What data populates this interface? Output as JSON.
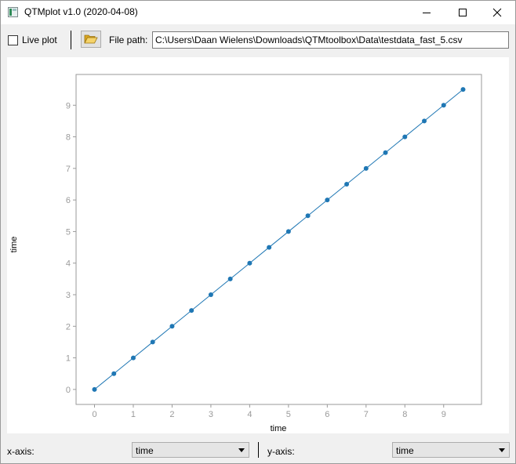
{
  "window": {
    "title": "QTMplot v1.0 (2020-04-08)",
    "icon": "app-icon"
  },
  "toolbar": {
    "live_plot_label": "Live plot",
    "live_plot_checked": false,
    "folder_icon": "folder-open-icon",
    "file_path_label": "File path:",
    "file_path_value": "C:\\Users\\Daan Wielens\\Downloads\\QTMtoolbox\\Data\\testdata_fast_5.csv"
  },
  "chart_data": {
    "type": "line",
    "x": [
      0,
      0.5,
      1,
      1.5,
      2,
      2.5,
      3,
      3.5,
      4,
      4.5,
      5,
      5.5,
      6,
      6.5,
      7,
      7.5,
      8,
      8.5,
      9,
      9.5
    ],
    "series": [
      {
        "values": [
          0,
          0.5,
          1,
          1.5,
          2,
          2.5,
          3,
          3.5,
          4,
          4.5,
          5,
          5.5,
          6,
          6.5,
          7,
          7.5,
          8,
          8.5,
          9,
          9.5
        ],
        "color": "#1f77b4"
      }
    ],
    "xlabel": "time",
    "ylabel": "time",
    "xticks": [
      0,
      1,
      2,
      3,
      4,
      5,
      6,
      7,
      8,
      9
    ],
    "yticks": [
      0,
      1,
      2,
      3,
      4,
      5,
      6,
      7,
      8,
      9
    ],
    "xlim": [
      -0.475,
      9.975
    ],
    "ylim": [
      -0.475,
      9.975
    ],
    "markers": true,
    "grid": false
  },
  "bottom": {
    "x_axis_label": "x-axis:",
    "x_axis_value": "time",
    "y_axis_label": "y-axis:",
    "y_axis_value": "time"
  }
}
